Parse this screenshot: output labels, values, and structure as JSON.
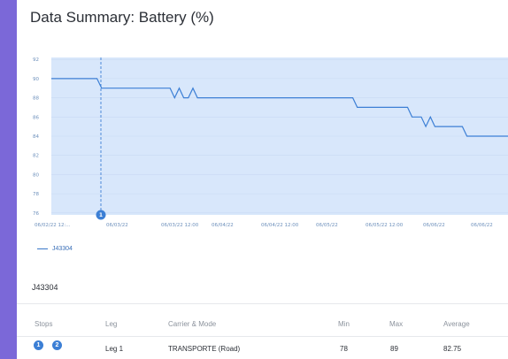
{
  "title": "Data Summary: Battery (%)",
  "chart_data": {
    "type": "line",
    "title": "",
    "xlabel": "",
    "ylabel": "",
    "x_ticks": [
      "06/02/22 12:...",
      "06/03/22",
      "06/03/22 12:00",
      "06/04/22",
      "06/04/22 12:00",
      "06/05/22",
      "06/05/22 12:00",
      "06/06/22",
      "06/06/22"
    ],
    "y_ticks": [
      92,
      90,
      88,
      86,
      84,
      82,
      80,
      78,
      76
    ],
    "ylim": [
      75.8,
      92.2
    ],
    "marker_label": "1",
    "series": [
      {
        "name": "J43304",
        "x": [
          0.0,
          0.07,
          0.1,
          0.11,
          0.12,
          0.26,
          0.27,
          0.28,
          0.29,
          0.3,
          0.31,
          0.32,
          0.33,
          0.39,
          0.4,
          0.41,
          0.42,
          0.43,
          0.44,
          0.45,
          0.46,
          0.62,
          0.63,
          0.64,
          0.66,
          0.67,
          0.68,
          0.69,
          0.7,
          0.71,
          0.72,
          0.73,
          0.78,
          0.79,
          0.8,
          0.81,
          0.82,
          0.83,
          0.84,
          0.85,
          0.86,
          0.87,
          0.88,
          0.9,
          0.91,
          0.92,
          0.93,
          0.94,
          0.97,
          0.99,
          1.0
        ],
        "values": [
          90,
          90,
          90,
          89,
          89,
          89,
          88,
          89,
          88,
          88,
          89,
          88,
          88,
          88,
          88,
          88,
          88,
          88,
          88,
          88,
          88,
          88,
          88,
          88,
          88,
          87,
          87,
          87,
          87,
          87,
          87,
          87,
          87,
          86,
          86,
          86,
          85,
          86,
          85,
          85,
          85,
          85,
          85,
          85,
          84,
          84,
          84,
          84,
          84,
          84,
          84
        ]
      }
    ]
  },
  "legend": {
    "label": "J43304"
  },
  "table": {
    "title": "J43304",
    "headers": [
      "Stops",
      "Leg",
      "Carrier & Mode",
      "Min",
      "Max",
      "Average"
    ],
    "rows": [
      {
        "stops": [
          "1",
          "2"
        ],
        "leg": "Leg 1",
        "carrier": "TRANSPORTE (Road)",
        "min": "78",
        "max": "89",
        "avg": "82.75"
      }
    ]
  },
  "colors": {
    "accent": "#3c7fd5",
    "plot_fill": "#d8e7fb",
    "line": "#3c7fd5",
    "bg_frame": "#7b68d8"
  }
}
